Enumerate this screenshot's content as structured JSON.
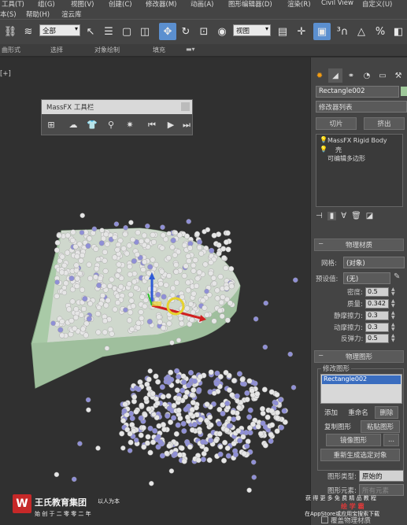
{
  "menubar": {
    "items": [
      "工具(T)",
      "组(G)",
      "视图(V)",
      "创建(C)",
      "修改器(M)",
      "动画(A)",
      "图形编辑器(D)",
      "渲染(R)",
      "Civil View",
      "自定义(U)",
      "本(S)",
      "帮助(H)",
      "渲云库"
    ]
  },
  "toolbar": {
    "selection_filter": "全部",
    "ref_coord": "视图"
  },
  "ribbon": {
    "tabs": [
      "曲形式",
      "选择",
      "对象绘制",
      "填充"
    ]
  },
  "viewport": {
    "label": "[+]"
  },
  "massfx_toolbar": {
    "title": "MassFX 工具栏"
  },
  "command_panel": {
    "object_name": "Rectangle002",
    "modifier_list": "修改器列表",
    "slice_button": "切片",
    "extrude_button": "挤出",
    "stack": [
      "MassFX Rigid Body",
      "壳",
      "可编辑多边形"
    ]
  },
  "physical_material": {
    "header": "物理材质",
    "mesh_label": "网格:",
    "mesh_value": "(对象)",
    "preset_label": "预设值:",
    "preset_value": "(无)",
    "density_label": "密度:",
    "density_value": "0.5",
    "mass_label": "质量:",
    "mass_value": "0.342",
    "static_friction_label": "静摩擦力:",
    "static_friction_value": "0.3",
    "dynamic_friction_label": "动摩擦力:",
    "dynamic_friction_value": "0.3",
    "bounce_label": "反弹力:",
    "bounce_value": "0.5"
  },
  "physical_shapes": {
    "header": "物理图形",
    "group_label": "修改图形",
    "list_item": "Rectangle002",
    "add_button": "添加",
    "rename_button": "重命名",
    "delete_button": "删除",
    "copy_button": "复制图形",
    "paste_button": "粘贴图形",
    "mirror_button": "镜像图形",
    "more_button": "...",
    "regen_button": "重新生成选定对象",
    "shape_type_label": "图形类型:",
    "shape_type_value": "原始的",
    "shape_element_label": "图形元素:",
    "shape_element_value": "所有元素",
    "override_label": "覆盖物理材质"
  },
  "watermark": {
    "logo_letter": "W",
    "company": "王氏教育集团",
    "slogan": "以人为本",
    "founded": "始 创 于 二 零 零 二 年",
    "promo_line1": "获 得 更 多 免 费 精 品 教 程",
    "promo_line2": "绘 学 霸",
    "promo_line3": "在AppStore或应用宝搜索下载"
  },
  "colors": {
    "accent_blue": "#5b8fcf",
    "container_green": "#a8c9a6",
    "sphere_white": "#e6e6e6",
    "sphere_purple": "#8f8fd6",
    "logo_red": "#c62828"
  }
}
